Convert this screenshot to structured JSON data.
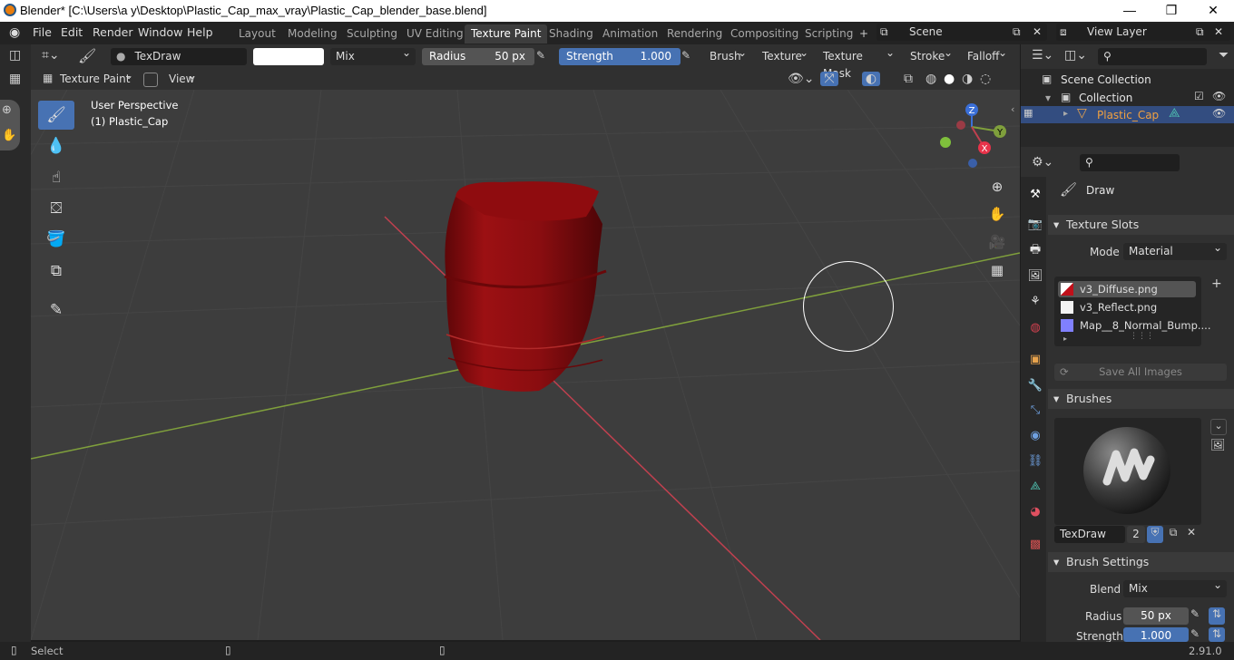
{
  "window": {
    "title": "Blender* [C:\\Users\\a y\\Desktop\\Plastic_Cap_max_vray\\Plastic_Cap_blender_base.blend]",
    "minimize": "—",
    "maximize": "❐",
    "close": "✕"
  },
  "menu": [
    "File",
    "Edit",
    "Render",
    "Window",
    "Help"
  ],
  "workspaces": [
    "Layout",
    "Modeling",
    "Sculpting",
    "UV Editing",
    "Texture Paint",
    "Shading",
    "Animation",
    "Rendering",
    "Compositing",
    "Scripting"
  ],
  "active_workspace": "Texture Paint",
  "scene": "Scene",
  "view_layer": "View Layer",
  "tool_header": {
    "brush_name": "TexDraw",
    "blend": "Mix",
    "radius_label": "Radius",
    "radius_value": "50 px",
    "strength_label": "Strength",
    "strength_value": "1.000",
    "menus": [
      "Brush",
      "Texture",
      "Texture Mask",
      "Stroke",
      "Falloff"
    ]
  },
  "viewport_header": {
    "mode": "Texture Paint",
    "view": "View"
  },
  "viewport": {
    "perspective": "User Perspective",
    "object": "(1) Plastic_Cap"
  },
  "gizmo": {
    "z": "Z",
    "y": "Y",
    "x": "X"
  },
  "outliner": {
    "scene_collection": "Scene Collection",
    "collection": "Collection",
    "object": "Plastic_Cap"
  },
  "properties": {
    "tool_name": "Draw",
    "texture_slots_title": "Texture Slots",
    "mode_label": "Mode",
    "mode_value": "Material",
    "slots": [
      "v3_Diffuse.png",
      "v3_Reflect.png",
      "Map__8_Normal_Bump...."
    ],
    "save_all": "Save All Images",
    "brushes_title": "Brushes",
    "brush_name": "TexDraw",
    "brush_users": "2",
    "brush_settings_title": "Brush Settings",
    "blend_label": "Blend",
    "blend_value": "Mix",
    "radius_label": "Radius",
    "radius_value": "50 px",
    "strength_label": "Strength",
    "strength_value": "1.000"
  },
  "status": {
    "select": "Select",
    "version": "2.91.0"
  },
  "colors": {
    "accent": "#4772b3",
    "object": "#a10f12",
    "x_axis": "#c0404f",
    "y_axis": "#7f9f3c"
  }
}
